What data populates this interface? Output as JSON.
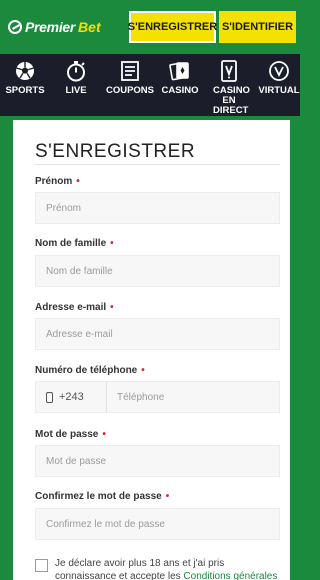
{
  "header": {
    "logo_premier": "Premier",
    "logo_bet": "Bet",
    "register_label": "S'ENREGISTRER",
    "login_label": "S'IDENTIFIER"
  },
  "nav": {
    "items": [
      {
        "label": "SPORTS",
        "icon": "soccer-ball-icon"
      },
      {
        "label": "LIVE",
        "icon": "stopwatch-icon"
      },
      {
        "label": "COUPONS",
        "icon": "coupon-icon"
      },
      {
        "label": "CASINO",
        "icon": "cards-icon"
      },
      {
        "label": "CASINO EN DIRECT",
        "icon": "live-casino-icon"
      },
      {
        "label": "VIRTUAL",
        "icon": "virtual-icon"
      }
    ]
  },
  "form": {
    "title": "S'ENREGISTRER",
    "required_mark": "•",
    "fields": {
      "first_name": {
        "label": "Prénom",
        "placeholder": "Prénom"
      },
      "last_name": {
        "label": "Nom de famille",
        "placeholder": "Nom de famille"
      },
      "email": {
        "label": "Adresse e-mail",
        "placeholder": "Adresse e-mail"
      },
      "phone": {
        "label": "Numéro de téléphone",
        "prefix": "+243",
        "placeholder": "Téléphone"
      },
      "password": {
        "label": "Mot de passe",
        "placeholder": "Mot de passe"
      },
      "confirm_password": {
        "label": "Confirmez le mot de passe",
        "placeholder": "Confirmez le mot de passe"
      }
    },
    "terms_text": "Je déclare avoir plus 18 ans et j'ai pris connaissance et accepte les ",
    "terms_link": "Conditions générales"
  },
  "colors": {
    "brand_green": "#1b8a3c",
    "accent_yellow": "#f5e100",
    "nav_dark": "#1c1d2b",
    "required_red": "#d0253a"
  }
}
